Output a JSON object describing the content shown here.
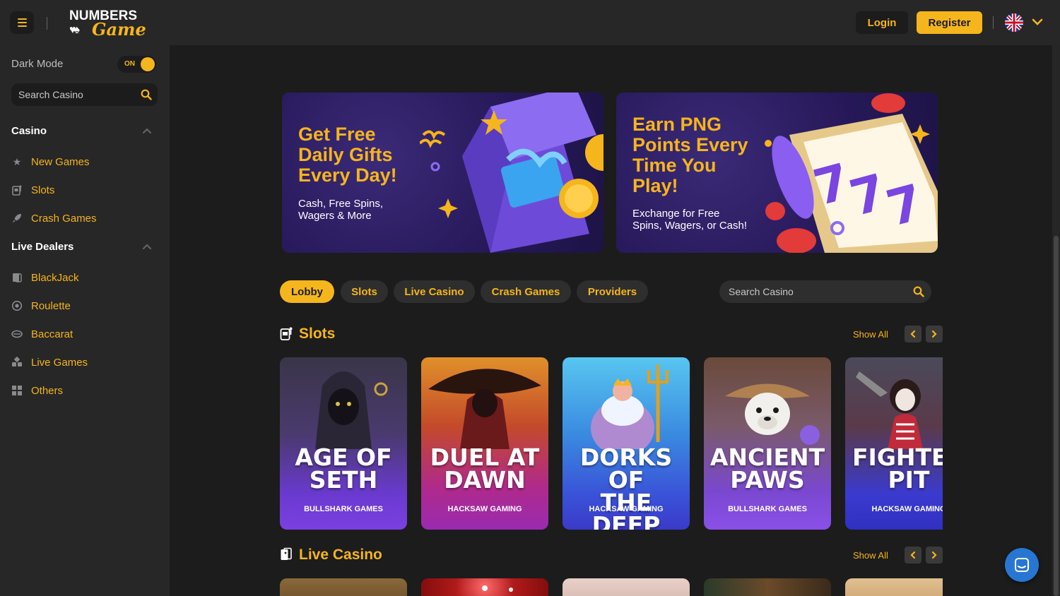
{
  "header": {
    "logo_top": "NUMBERS",
    "logo_bottom": "Game",
    "login_label": "Login",
    "register_label": "Register",
    "language_icon": "uk-flag-icon"
  },
  "sidebar": {
    "dark_mode_label": "Dark Mode",
    "dark_mode_state": "ON",
    "search_placeholder": "Search Casino",
    "sections": [
      {
        "title": "Casino",
        "items": [
          {
            "label": "New Games",
            "icon": "star-icon"
          },
          {
            "label": "Slots",
            "icon": "slot-machine-icon"
          },
          {
            "label": "Crash Games",
            "icon": "rocket-icon"
          }
        ]
      },
      {
        "title": "Live Dealers",
        "items": [
          {
            "label": "BlackJack",
            "icon": "cards-icon"
          },
          {
            "label": "Roulette",
            "icon": "roulette-icon"
          },
          {
            "label": "Baccarat",
            "icon": "baccarat-icon"
          },
          {
            "label": "Live Games",
            "icon": "dice-icon"
          },
          {
            "label": "Others",
            "icon": "grid-icon"
          }
        ]
      }
    ]
  },
  "banners": [
    {
      "title_lines": [
        "Get Free",
        "Daily Gifts",
        "Every Day!"
      ],
      "subtitle_lines": [
        "Cash, Free Spins,",
        "Wagers & More"
      ]
    },
    {
      "title_lines": [
        "Earn PNG",
        "Points Every",
        "Time You",
        "Play!"
      ],
      "subtitle_lines": [
        "Exchange for Free",
        "Spins, Wagers, or Cash!"
      ]
    }
  ],
  "tabs": [
    "Lobby",
    "Slots",
    "Live Casino",
    "Crash Games",
    "Providers"
  ],
  "active_tab": "Lobby",
  "main_search_placeholder": "Search Casino",
  "slots_section": {
    "title": "Slots",
    "show_all": "Show All",
    "games": [
      {
        "name_lines": [
          "AGE OF",
          "SETH"
        ],
        "provider": "BULLSHARK GAMES"
      },
      {
        "name_lines": [
          "DUEL AT",
          "DAWN"
        ],
        "provider": "HACKSAW GAMING"
      },
      {
        "name_lines": [
          "DORKS OF",
          "THE DEEP"
        ],
        "provider": "HACKSAW GAMING"
      },
      {
        "name_lines": [
          "ANCIENT",
          "PAWS"
        ],
        "provider": "BULLSHARK GAMES"
      },
      {
        "name_lines": [
          "FIGHTER",
          "PIT"
        ],
        "provider": "HACKSAW GAMING"
      }
    ]
  },
  "live_casino_section": {
    "title": "Live Casino",
    "show_all": "Show All"
  },
  "colors": {
    "accent": "#f5b51c",
    "background": "#1c1c1c",
    "panel": "#272727",
    "chat": "#2876d4"
  }
}
